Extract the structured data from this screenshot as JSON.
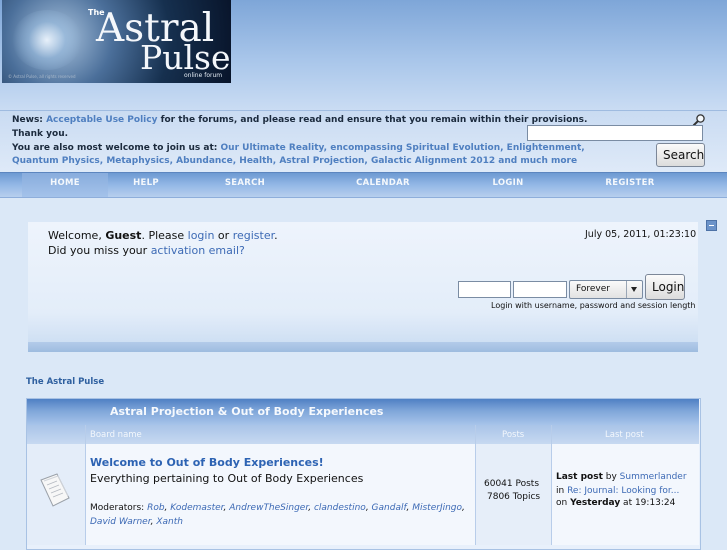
{
  "logo": {
    "the": "The",
    "word1": "Astral",
    "word2": "Pulse",
    "tagline": "online forum",
    "credit": "© Astral Pulse, all rights reserved"
  },
  "news": {
    "label": "News:",
    "link": "Acceptable Use Policy",
    "text1": " for the forums, and please read and ensure that you remain within their provisions.",
    "text2": "Thank you.",
    "text3": "You are also most welcome to join us at: ",
    "link2": "Our Ultimate Reality, encompassing Spiritual Evolution, Enlightenment,",
    "link3": "Quantum Physics, Metaphysics, Abundance, Health, Astral Projection, Galactic Alignment 2012 and much more"
  },
  "search": {
    "button": "Search",
    "value": ""
  },
  "nav": [
    {
      "label": "HOME",
      "active": true
    },
    {
      "label": "HELP"
    },
    {
      "label": "SEARCH"
    },
    {
      "label": "CALENDAR"
    },
    {
      "label": "LOGIN"
    },
    {
      "label": "REGISTER"
    }
  ],
  "user": {
    "welcome": "Welcome, ",
    "guest": "Guest",
    "please": ". Please ",
    "login": "login",
    "or": " or ",
    "register": "register",
    "dot": ".",
    "missed": "Did you miss your ",
    "activation": "activation email?",
    "date": "July 05, 2011, 01:23:10",
    "session": "Forever",
    "login_button": "Login",
    "hint": "Login with username, password and session length"
  },
  "breadcrumb": "The Astral Pulse",
  "category": {
    "title": "Astral Projection & Out of Body Experiences",
    "col_board": "Board name",
    "col_posts": "Posts",
    "col_last": "Last post"
  },
  "board": {
    "title": "Welcome to Out of Body Experiences!",
    "desc": "Everything pertaining to Out of Body Experiences",
    "mod_label": "Moderators: ",
    "moderators": [
      "Rob",
      "Kodemaster",
      "AndrewTheSinger",
      "clandestino",
      "Gandalf",
      "MisterJingo",
      "David Warner",
      "Xanth"
    ],
    "posts": "60041 Posts",
    "topics": "7806 Topics",
    "last_by_label": "Last post",
    "last_by_word": " by ",
    "last_user": "Summerlander",
    "in_word": "in ",
    "last_topic": "Re: Journal: Looking for...",
    "on_word": "on ",
    "when": "Yesterday",
    "at": " at 19:13:24"
  },
  "colors": {
    "link": "#3d6ab5",
    "nav_bar": "#94b8e6",
    "category_header": "#4f80c4"
  }
}
